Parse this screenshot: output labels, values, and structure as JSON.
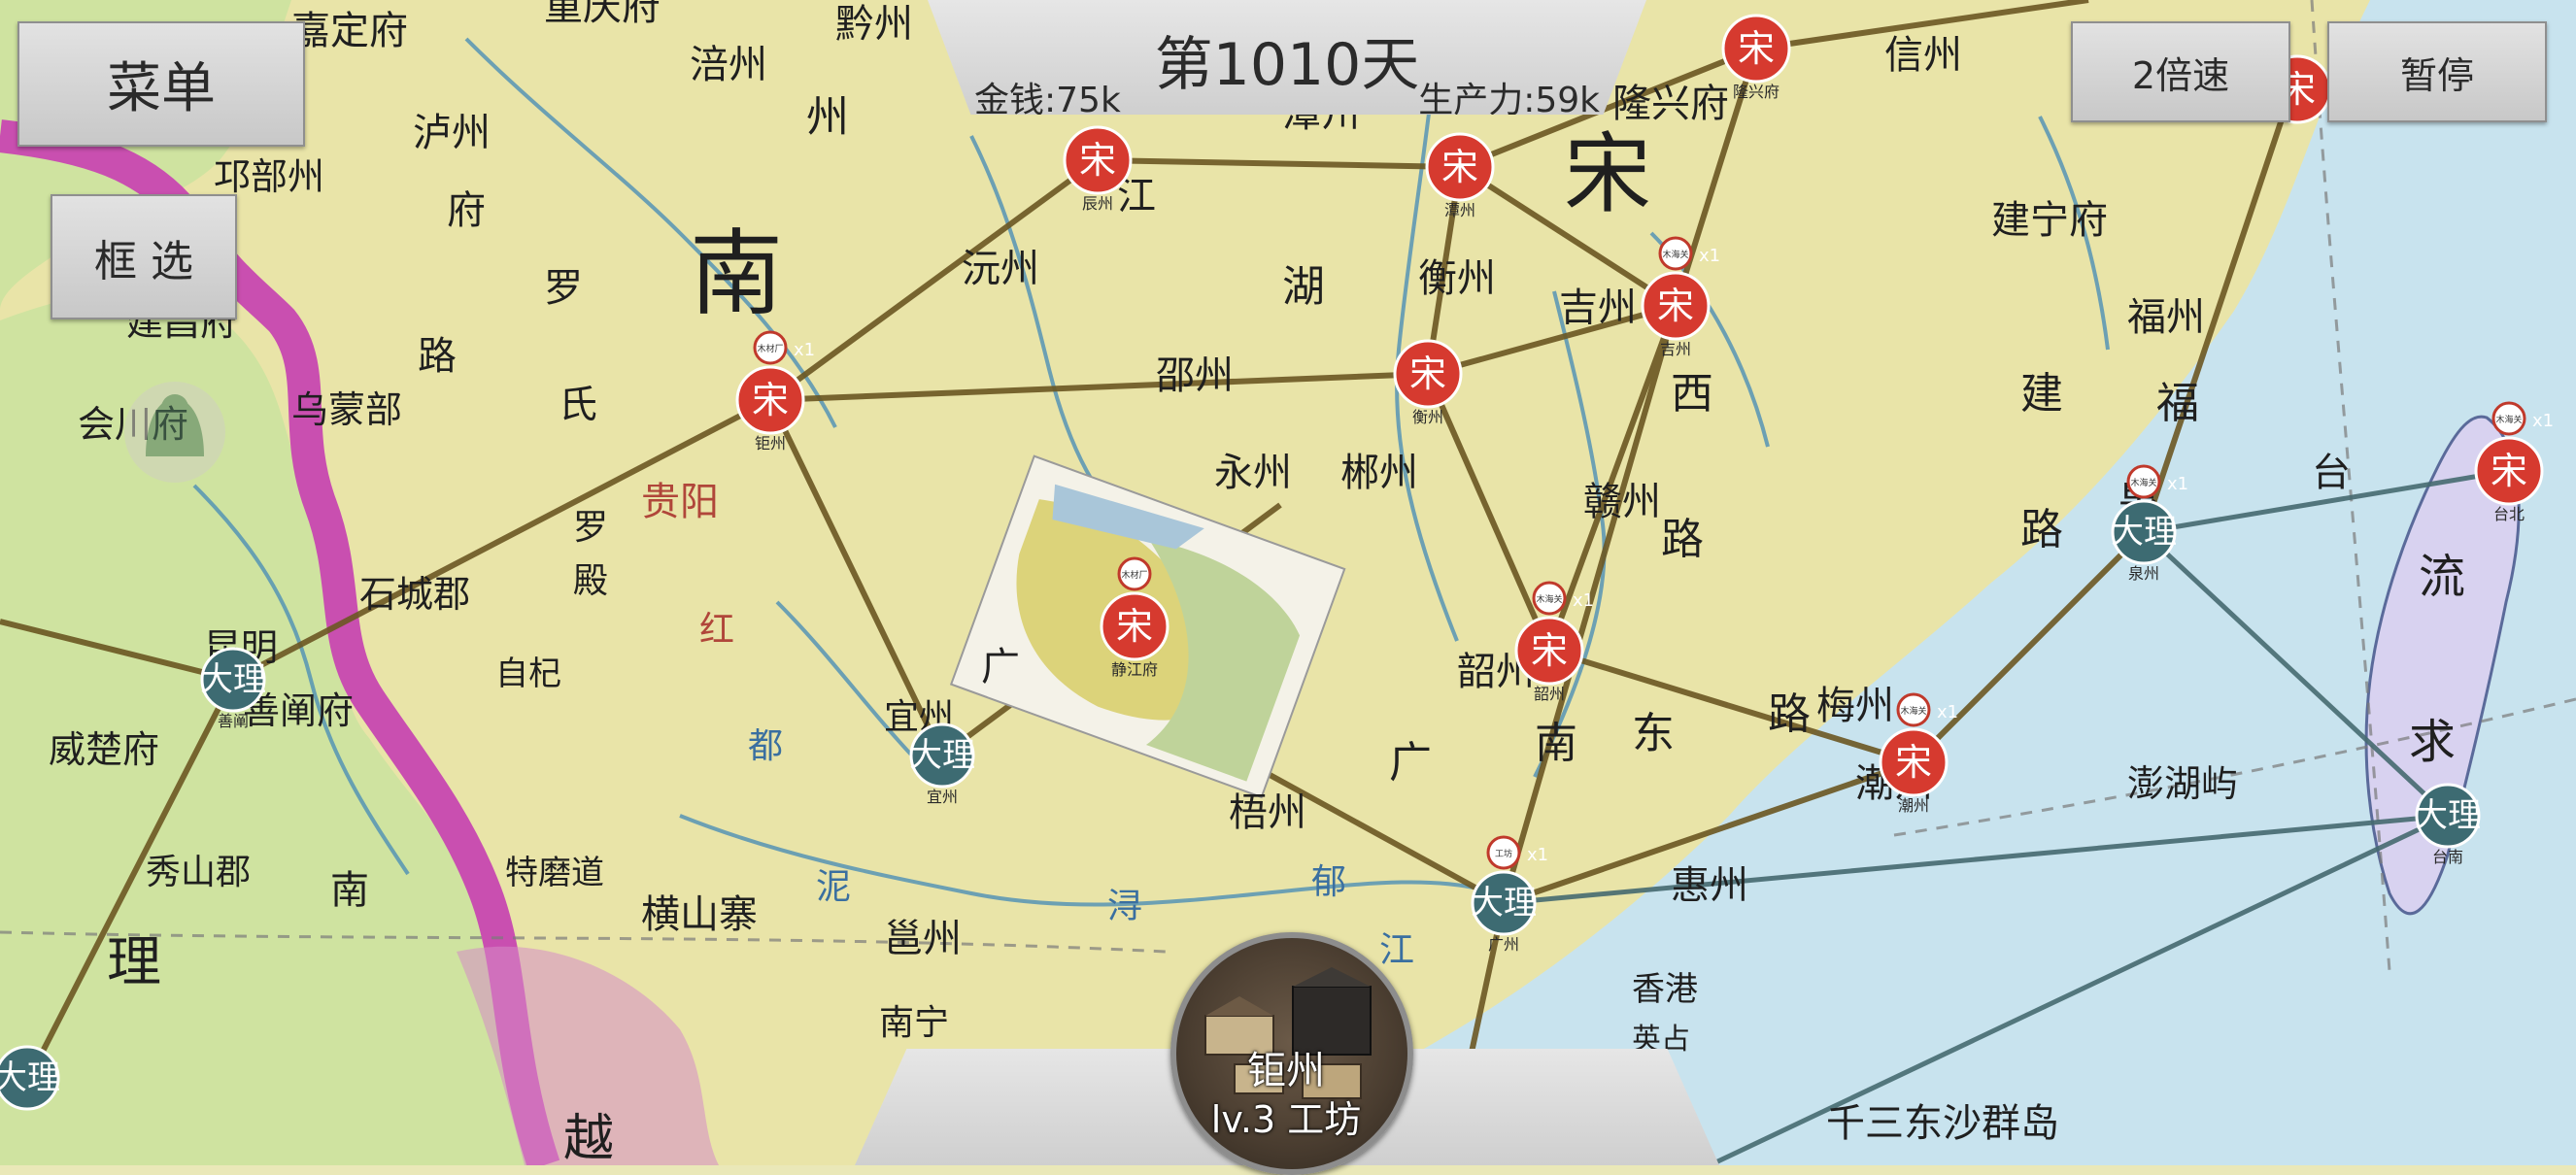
{
  "hud": {
    "day": "第1010天",
    "money": "金钱:75k",
    "productivity": "生产力:59k"
  },
  "buttons": {
    "menu": "菜单",
    "box_select": "框 选",
    "speed": "2倍速",
    "pause": "暂停"
  },
  "selected_city": {
    "name": "钜州",
    "level": "lv.3 工坊"
  },
  "factions": {
    "song": {
      "label": "宋",
      "color": "#d63a2f"
    },
    "dali": {
      "label": "大理",
      "color": "#3d6b72"
    }
  },
  "colors": {
    "route": "#6b5722",
    "sea": "#c8e3ee",
    "land": "#e9e4a8",
    "border_pink": "#c94fb0"
  },
  "map_labels": [
    "嘉定府",
    "重庆府",
    "黔州",
    "涪州",
    "泸州",
    "邛部州",
    "府",
    "南",
    "州",
    "罗",
    "氏",
    "路",
    "乌蒙部",
    "会川府",
    "建昌府",
    "贵阳",
    "罗",
    "殿",
    "石城郡",
    "昆明",
    "善阐府",
    "威楚府",
    "自杞",
    "宜州",
    "广",
    "沅州",
    "邵州",
    "湖",
    "永州",
    "郴州",
    "衡州",
    "潭州",
    "江",
    "吉州",
    "西",
    "赣州",
    "路",
    "韶州",
    "南",
    "东",
    "路",
    "梅州",
    "广",
    "梧州",
    "潮州",
    "惠州",
    "香港",
    "英占",
    "宋",
    "隆兴府",
    "信州",
    "建宁府",
    "福州",
    "福",
    "建",
    "泉",
    "路",
    "台",
    "流",
    "求",
    "澎湖屿",
    "千三东沙群岛",
    "邕州",
    "南宁",
    "横山寨",
    "特磨道",
    "秀山郡",
    "理",
    "南",
    "越",
    "都",
    "郁",
    "泥",
    "浔",
    "江",
    "红"
  ],
  "cities": [
    {
      "faction": "song",
      "sub": "辰州",
      "x1": false
    },
    {
      "faction": "song",
      "sub": "潭州",
      "x1": false
    },
    {
      "faction": "song",
      "sub": "隆兴府",
      "x1": false
    },
    {
      "faction": "song",
      "sub": "吉州",
      "x1": true,
      "flag": "木海关"
    },
    {
      "faction": "song",
      "sub": "钜州",
      "x1": true,
      "flag": "木材厂"
    },
    {
      "faction": "song",
      "sub": "衡州",
      "x1": false
    },
    {
      "faction": "song",
      "sub": "静江府",
      "x1": false,
      "flag": "木材厂"
    },
    {
      "faction": "song",
      "sub": "韶州",
      "x1": true,
      "flag": "木海关"
    },
    {
      "faction": "song",
      "sub": "潮州",
      "x1": true,
      "flag": "木海关"
    },
    {
      "faction": "song",
      "sub": "台北",
      "x1": true,
      "flag": "木海关"
    },
    {
      "faction": "song",
      "sub": "",
      "x1": false
    },
    {
      "faction": "dali",
      "sub": "善阐",
      "x1": false
    },
    {
      "faction": "dali",
      "sub": "宜州",
      "x1": false
    },
    {
      "faction": "dali",
      "sub": "广州",
      "x1": true,
      "flag": "工坊"
    },
    {
      "faction": "dali",
      "sub": "泉州",
      "x1": true,
      "flag": "木海关"
    },
    {
      "faction": "dali",
      "sub": "台南",
      "x1": false
    },
    {
      "faction": "dali",
      "sub": "",
      "x1": false
    }
  ],
  "route_count": 26
}
